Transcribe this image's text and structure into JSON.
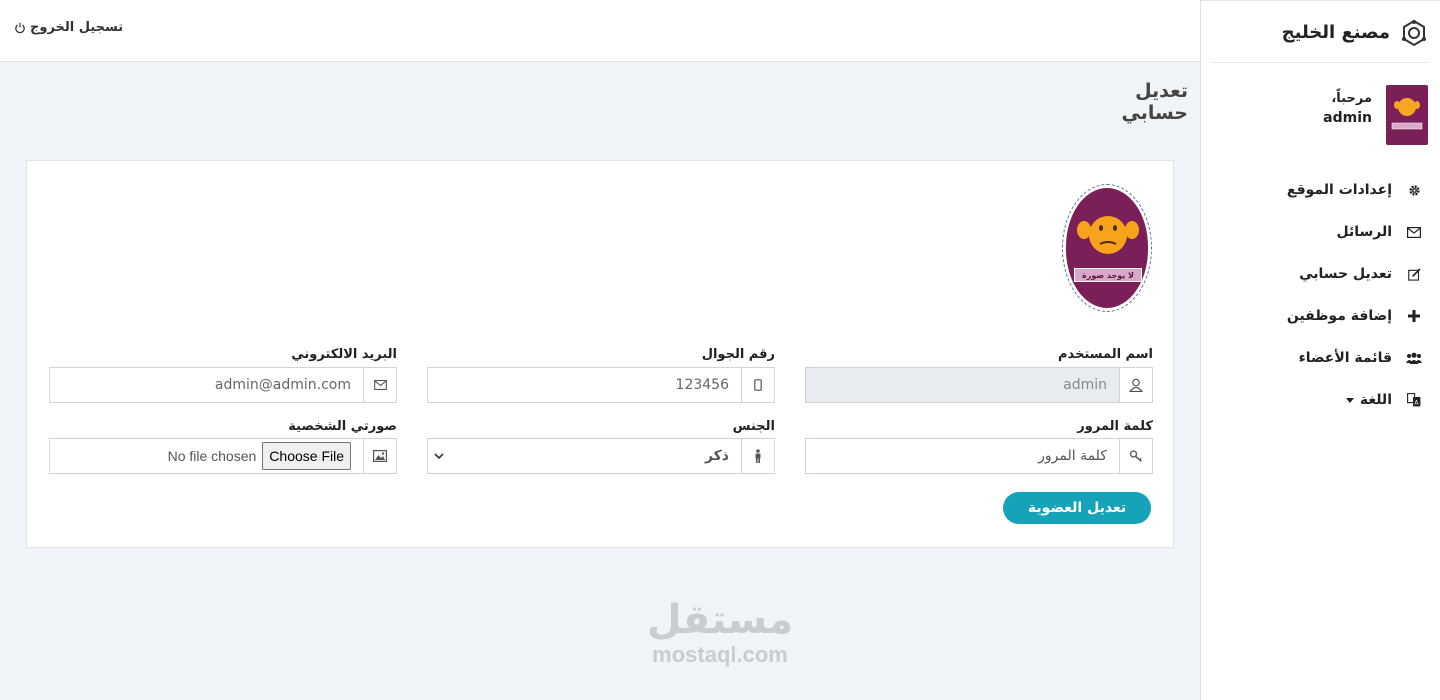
{
  "brand": {
    "name": "مصنع الخليج"
  },
  "user": {
    "welcome": "مرحباً،",
    "name": "admin",
    "avatar_caption": "لا يوجد صورة"
  },
  "nav": [
    {
      "label": "إعدادات الموقع",
      "icon": "gear-icon"
    },
    {
      "label": "الرسائل",
      "icon": "envelope-icon"
    },
    {
      "label": "تعديل حسابي",
      "icon": "edit-icon"
    },
    {
      "label": "إضافة موظفين",
      "icon": "plus-icon"
    },
    {
      "label": "قائمة الأعضاء",
      "icon": "users-icon"
    },
    {
      "label": "اللغة",
      "icon": "language-icon"
    }
  ],
  "topbar": {
    "logout_label": "تسجيل الخروج"
  },
  "page": {
    "title": "تعديل حسابي"
  },
  "form": {
    "username": {
      "label": "اسم المستخدم",
      "value": "admin"
    },
    "phone": {
      "label": "رقم الجوال",
      "value": "123456"
    },
    "email": {
      "label": "البريد الالكتروني",
      "value": "admin@admin.com"
    },
    "password": {
      "label": "كلمة المرور",
      "placeholder": "كلمة المرور"
    },
    "gender": {
      "label": "الجنس",
      "selected": "ذكر"
    },
    "photo": {
      "label": "صورتي الشخصية",
      "button": "Choose File",
      "status": "No file chosen"
    },
    "submit_label": "تعديل العضوية"
  },
  "watermark": {
    "arabic": "مستقل",
    "latin": "mostaql.com"
  }
}
